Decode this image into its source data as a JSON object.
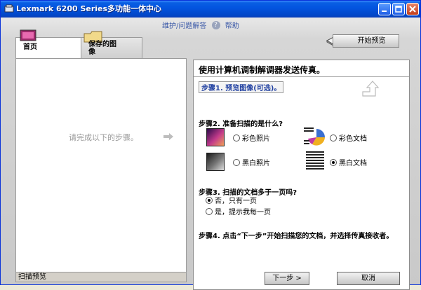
{
  "window": {
    "title": "Lexmark 6200 Series多功能一体中心"
  },
  "top_links": {
    "maintenance": "维护/问题解答",
    "help": "帮助"
  },
  "toolbar": {
    "start_preview": "开始预览"
  },
  "tabs": [
    {
      "label": "首页"
    },
    {
      "label": "保存的图像"
    }
  ],
  "left_panel": {
    "message": "请完成以下的步骤。",
    "footer": "扫描预览"
  },
  "right_panel": {
    "title": "使用计算机调制解调器发送传真。",
    "step1": "步骤1. 预览图像(可选)。",
    "step2": {
      "heading": "步骤2.  准备扫描的是什么?",
      "options": [
        "彩色照片",
        "彩色文档",
        "黑白照片",
        "黑白文档"
      ],
      "selected": "黑白文档"
    },
    "step3": {
      "heading": "步骤3.  扫描的文档多于一页吗?",
      "options": [
        "否，只有一页",
        "是，提示我每一页"
      ],
      "selected": "否，只有一页"
    },
    "step4": "步骤4.  点击“下一步”开始扫描您的文档，并选择传真接收者。",
    "buttons": {
      "next": "下一步 >",
      "cancel": "取消"
    }
  },
  "colors": {
    "titlebar": "#0355e0",
    "link": "#1f3fa0"
  }
}
